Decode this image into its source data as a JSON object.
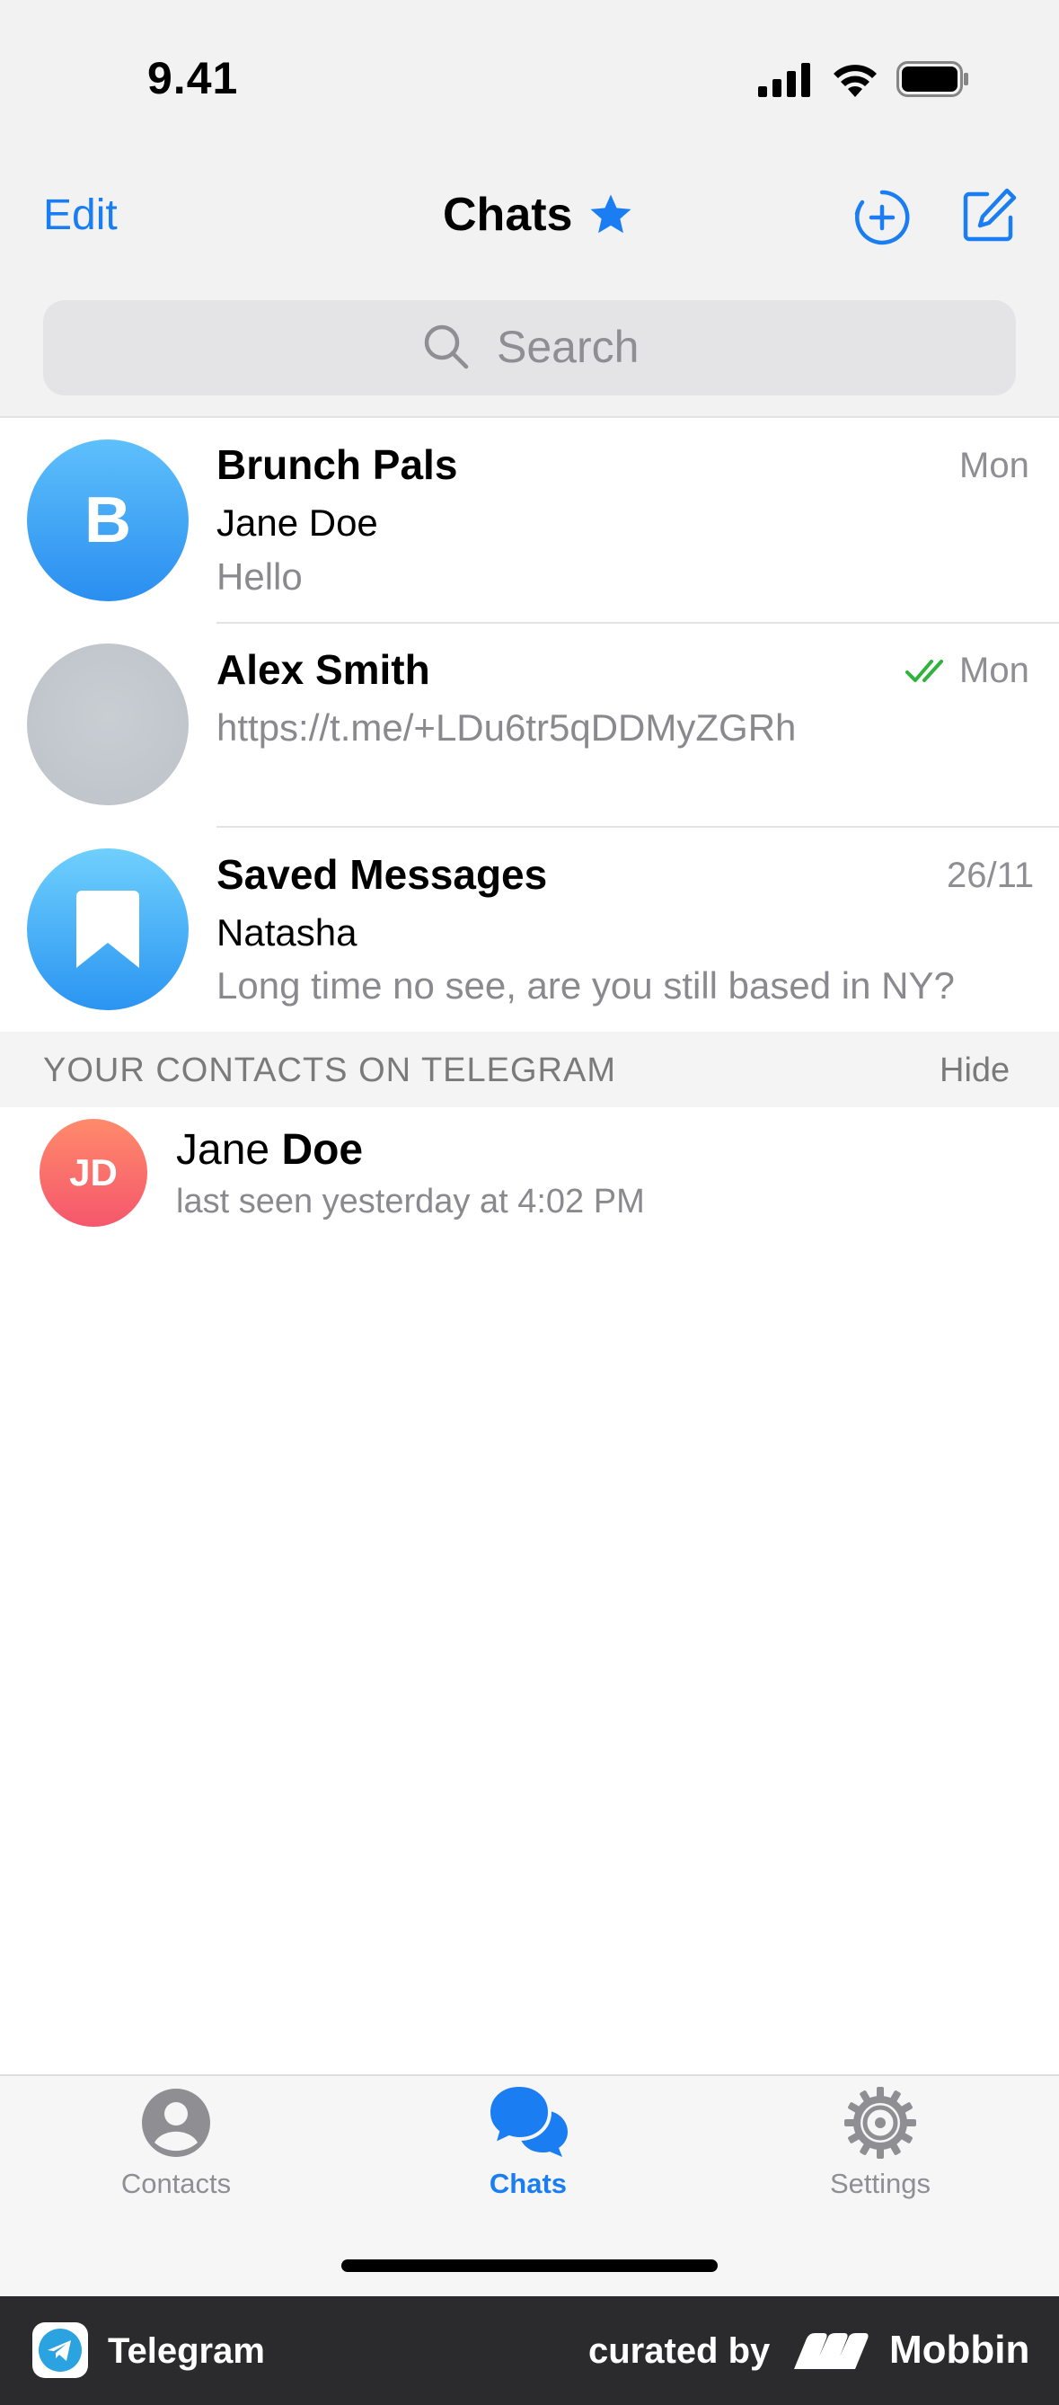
{
  "status_bar": {
    "time": "9.41"
  },
  "nav": {
    "edit_label": "Edit",
    "title": "Chats"
  },
  "search": {
    "placeholder": "Search"
  },
  "chats": [
    {
      "name": "Brunch Pals",
      "avatar_text": "B",
      "sender": "Jane Doe",
      "message": "Hello",
      "date": "Mon"
    },
    {
      "name": "Alex Smith",
      "message": "https://t.me/+LDu6tr5qDDMyZGRh",
      "date": "Mon",
      "read_status": "double-check"
    },
    {
      "name": "Saved Messages",
      "sender": "Natasha",
      "message": "Long time no see, are you still based in NY?",
      "date": "26/11"
    }
  ],
  "contacts_section": {
    "title": "YOUR CONTACTS ON TELEGRAM",
    "hide_label": "Hide",
    "contacts": [
      {
        "avatar_text": "JD",
        "name_first": "Jane",
        "name_last": "Doe",
        "status": "last seen yesterday at 4:02 PM"
      }
    ]
  },
  "tabs": [
    {
      "label": "Contacts",
      "icon": "person-icon",
      "active": false
    },
    {
      "label": "Chats",
      "icon": "chat-bubbles-icon",
      "active": true
    },
    {
      "label": "Settings",
      "icon": "gear-icon",
      "active": false
    }
  ],
  "footer": {
    "app_name": "Telegram",
    "curated_by": "curated by",
    "brand": "Mobbin"
  },
  "colors": {
    "accent": "#1a7ef2",
    "check_green": "#2fb33b",
    "inactive_tab": "#8e8e93"
  }
}
